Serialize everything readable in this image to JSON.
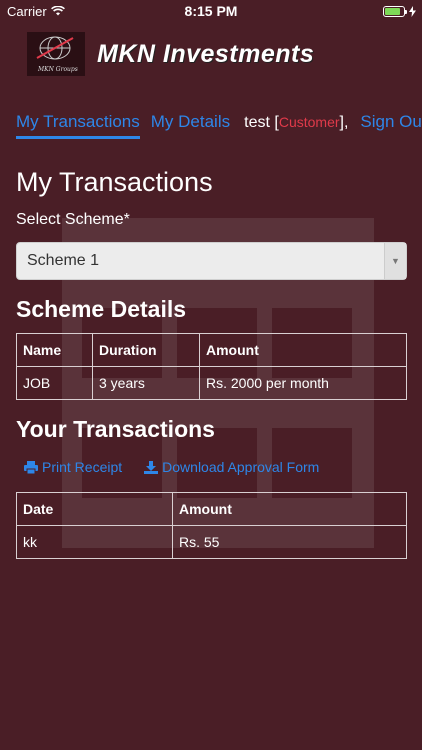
{
  "status_bar": {
    "carrier": "Carrier",
    "time": "8:15 PM",
    "battery_level": 0.85
  },
  "brand": {
    "logo_caption": "MKN Groups",
    "name": "MKN Investments"
  },
  "nav": {
    "tab_transactions": "My Transactions",
    "tab_details": "My Details",
    "user": "test",
    "role_open": "[",
    "role": "Customer",
    "role_close": "],",
    "sign_out": "Sign Out"
  },
  "page": {
    "title": "My Transactions",
    "select_label": "Select Scheme*",
    "select_value": "Scheme 1"
  },
  "scheme_details": {
    "title": "Scheme Details",
    "headers": [
      "Name",
      "Duration",
      "Amount"
    ],
    "rows": [
      [
        "JOB",
        "3 years",
        "Rs. 2000 per month"
      ]
    ]
  },
  "transactions": {
    "title": "Your Transactions",
    "print_receipt": "Print Receipt",
    "download_form": "Download Approval Form",
    "headers": [
      "Date",
      "Amount"
    ],
    "rows": [
      [
        "kk",
        "Rs. 55"
      ]
    ]
  },
  "colors": {
    "background": "#4a1e26",
    "link": "#2e86e8",
    "role": "#e03a4a"
  }
}
